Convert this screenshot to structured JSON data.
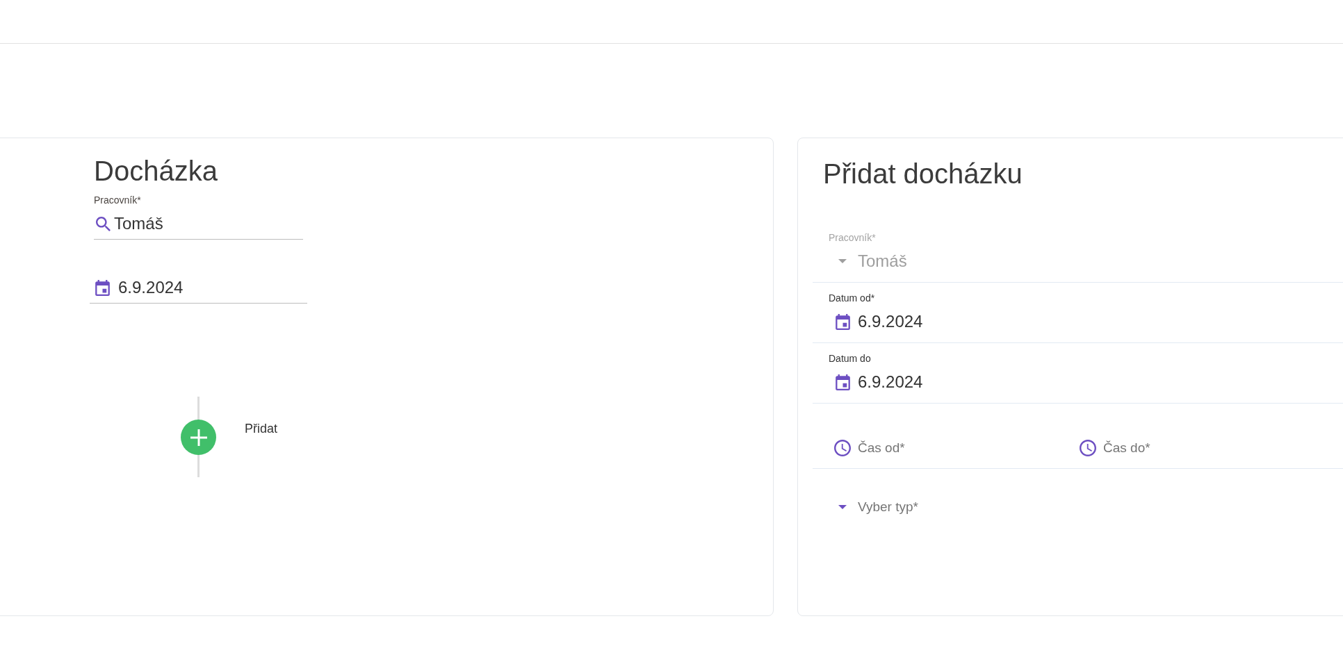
{
  "attendance": {
    "title": "Docházka",
    "worker_field": {
      "label": "Pracovník*",
      "value": "Tomáš"
    },
    "date_field": {
      "value": "6.9.2024"
    },
    "timeline": [
      {
        "kind": "add",
        "label": "Přidat"
      }
    ]
  },
  "add_attendance": {
    "title": "Přidat docházku",
    "fields": [
      {
        "kind": "select",
        "label": "Pracovník*",
        "value": "Tomáš",
        "disabled": true
      },
      {
        "kind": "date",
        "label": "Datum od*",
        "value": "6.9.2024",
        "disabled": false
      },
      {
        "kind": "date",
        "label": "Datum do",
        "value": "6.9.2024",
        "disabled": false
      },
      {
        "kind": "time_pair",
        "disabled": false,
        "inputs": [
          {
            "placeholder": "Čas od*"
          },
          {
            "placeholder": "Čas do*"
          }
        ]
      },
      {
        "kind": "select",
        "placeholder": "Vyber typ*",
        "disabled": false
      }
    ]
  }
}
